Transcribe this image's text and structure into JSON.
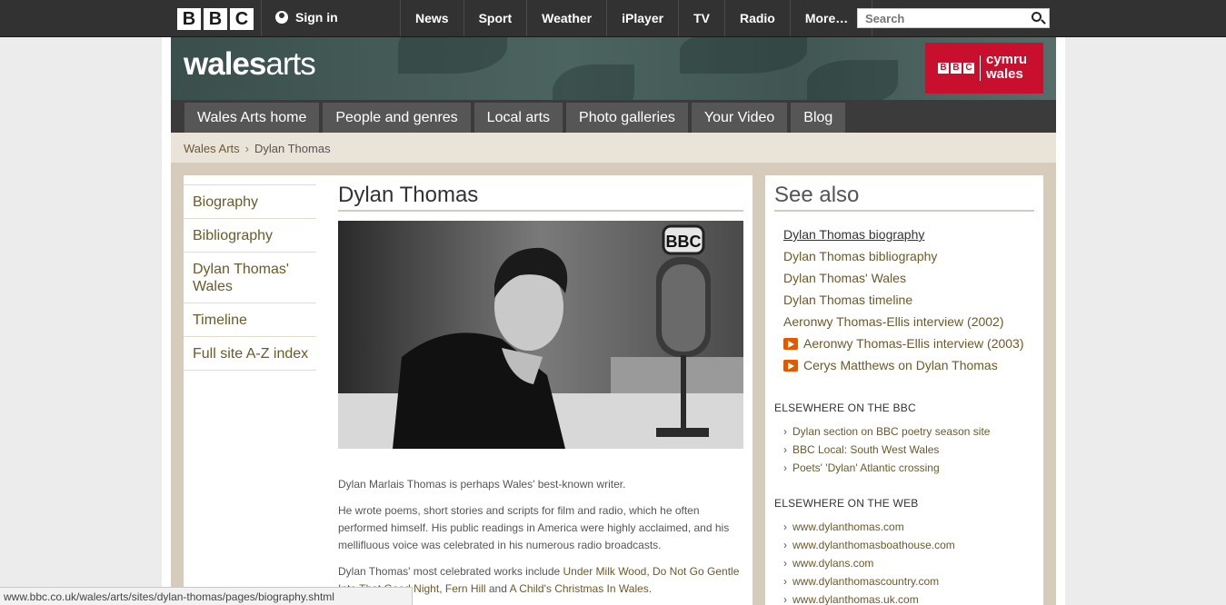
{
  "bbc_bar": {
    "logo": [
      "B",
      "B",
      "C"
    ],
    "sign_in": "Sign in",
    "nav": [
      "News",
      "Sport",
      "Weather",
      "iPlayer",
      "TV",
      "Radio",
      "More…"
    ],
    "search_placeholder": "Search"
  },
  "banner": {
    "title_bold": "wales",
    "title_light": "arts",
    "badge_logo": [
      "B",
      "B",
      "C"
    ],
    "badge_line1": "cymru",
    "badge_line2": "wales",
    "badge_color": "#c8102e"
  },
  "main_nav": [
    "Wales Arts home",
    "People and genres",
    "Local arts",
    "Photo galleries",
    "Your Video",
    "Blog"
  ],
  "breadcrumb": {
    "parent": "Wales Arts",
    "current": "Dylan Thomas"
  },
  "left_nav": [
    "Biography",
    "Bibliography",
    "Dylan Thomas' Wales",
    "Timeline",
    "Full site A-Z index"
  ],
  "article": {
    "title": "Dylan Thomas",
    "photo_mic_label": "BBC",
    "para1": "Dylan Marlais Thomas is perhaps Wales' best-known writer.",
    "para2": "He wrote poems, short stories and scripts for film and radio, which he often performed himself. His public readings in America were highly acclaimed, and his mellifluous voice was celebrated in his numerous radio broadcasts.",
    "para3_prefix": "Dylan Thomas' most celebrated works include ",
    "para3_link1": "Under Milk Wood",
    "para3_sep1": ", ",
    "para3_link2": "Do Not Go Gentle Into That Good Night",
    "para3_sep2": ", ",
    "para3_link3": "Fern Hill",
    "para3_sep3": " and ",
    "para3_link4": "A Child's Christmas In Wales",
    "para3_end": "."
  },
  "see_also": {
    "title": "See also",
    "links": [
      {
        "label": "Dylan Thomas biography",
        "video": false
      },
      {
        "label": "Dylan Thomas bibliography",
        "video": false
      },
      {
        "label": "Dylan Thomas' Wales",
        "video": false
      },
      {
        "label": "Dylan Thomas timeline",
        "video": false
      },
      {
        "label": "Aeronwy Thomas-Ellis interview (2002)",
        "video": false
      },
      {
        "label": "Aeronwy Thomas-Ellis interview (2003)",
        "video": true
      },
      {
        "label": "Cerys Matthews on Dylan Thomas",
        "video": true
      }
    ],
    "bbc_heading": "ELSEWHERE ON THE BBC",
    "bbc_links": [
      "Dylan section on BBC poetry season site",
      "BBC Local: South West Wales",
      "Poets' 'Dylan' Atlantic crossing"
    ],
    "web_heading": "ELSEWHERE ON THE WEB",
    "web_links": [
      "www.dylanthomas.com",
      "www.dylanthomasboathouse.com",
      "www.dylans.com",
      "www.dylanthomascountry.com",
      "www.dylanthomas.uk.com"
    ]
  },
  "status_url": "www.bbc.co.uk/wales/arts/sites/dylan-thomas/pages/biography.shtml"
}
